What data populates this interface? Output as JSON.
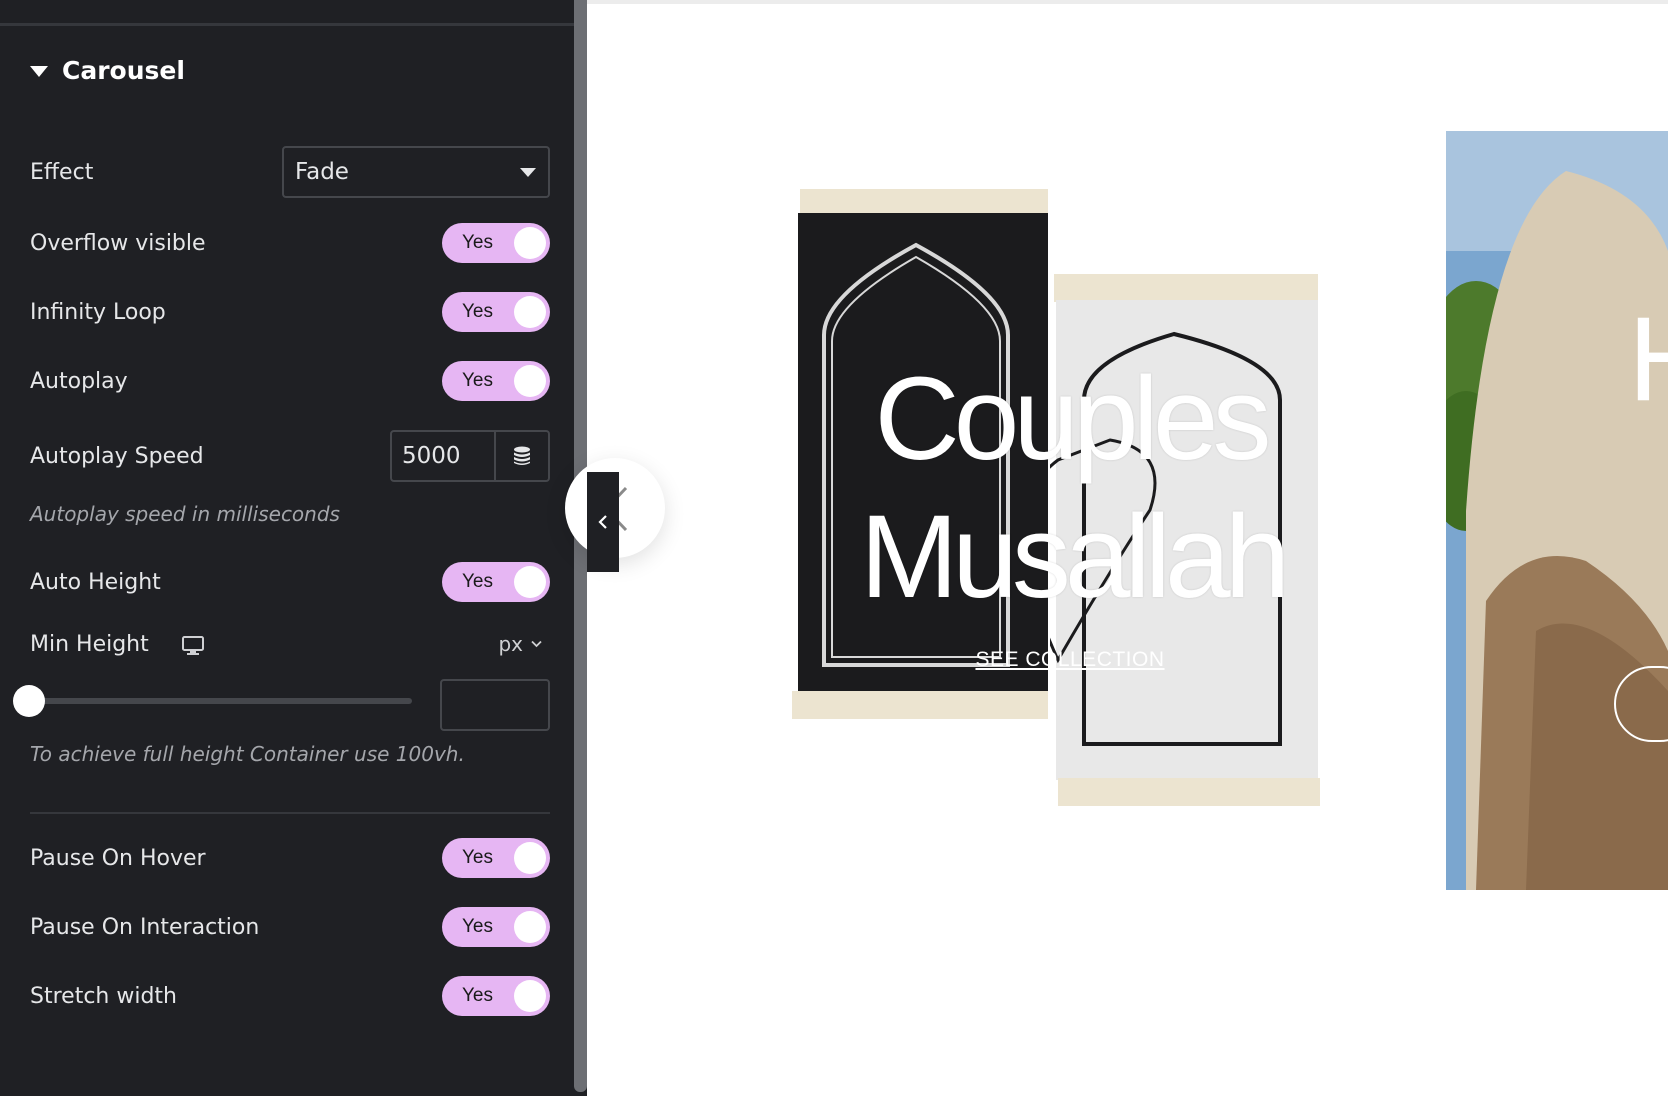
{
  "panel": {
    "section_title": "Carousel",
    "effect": {
      "label": "Effect",
      "value": "Fade"
    },
    "overflow_visible": {
      "label": "Overflow visible",
      "toggle": "Yes"
    },
    "infinity_loop": {
      "label": "Infinity Loop",
      "toggle": "Yes"
    },
    "autoplay": {
      "label": "Autoplay",
      "toggle": "Yes"
    },
    "autoplay_speed": {
      "label": "Autoplay Speed",
      "value": "5000",
      "hint": "Autoplay speed in milliseconds"
    },
    "auto_height": {
      "label": "Auto Height",
      "toggle": "Yes"
    },
    "min_height": {
      "label": "Min Height",
      "unit": "px",
      "slider_value": 0,
      "hint": "To achieve full height Container use 100vh."
    },
    "pause_on_hover": {
      "label": "Pause On Hover",
      "toggle": "Yes"
    },
    "pause_on_interaction": {
      "label": "Pause On Interaction",
      "toggle": "Yes"
    },
    "stretch_width": {
      "label": "Stretch width",
      "toggle": "Yes"
    },
    "icons": [
      "caret-down-icon",
      "dropdown-arrow-icon",
      "database-icon",
      "desktop-monitor-icon",
      "chevron-down-icon"
    ]
  },
  "preview": {
    "slide_title_line1": "Couples",
    "slide_title_line2": "Musallah",
    "slide_link": "SEE COLLECTION",
    "icons": [
      "chevron-left-icon",
      "collapse-panel-icon"
    ]
  },
  "colors": {
    "panel_bg": "#1f2024",
    "toggle_on": "#e6b6f3",
    "preview_bg": "#ffffff"
  }
}
